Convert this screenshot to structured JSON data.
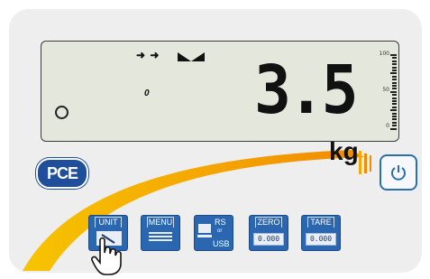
{
  "display": {
    "arrows": "➜ ➜",
    "zero_label": "0",
    "reading": "3.5",
    "unit": "kg",
    "scale_labels": [
      "100",
      "50",
      "0"
    ]
  },
  "brand": {
    "logo_text": "PCE",
    "accent": "#f5a800",
    "key_blue": "#2a67b0"
  },
  "keys": [
    {
      "label": "UNIT",
      "icon": "unit-tool-icon"
    },
    {
      "label": "MENU",
      "icon": "menu-list-icon"
    },
    {
      "label": "RS",
      "sub": "or",
      "bottom": "USB",
      "icon": "pc-connection-icon"
    },
    {
      "label": "ZERO",
      "screen": "0.000"
    },
    {
      "label": "TARE",
      "screen": "0.000"
    }
  ],
  "power_icon": "power-icon"
}
